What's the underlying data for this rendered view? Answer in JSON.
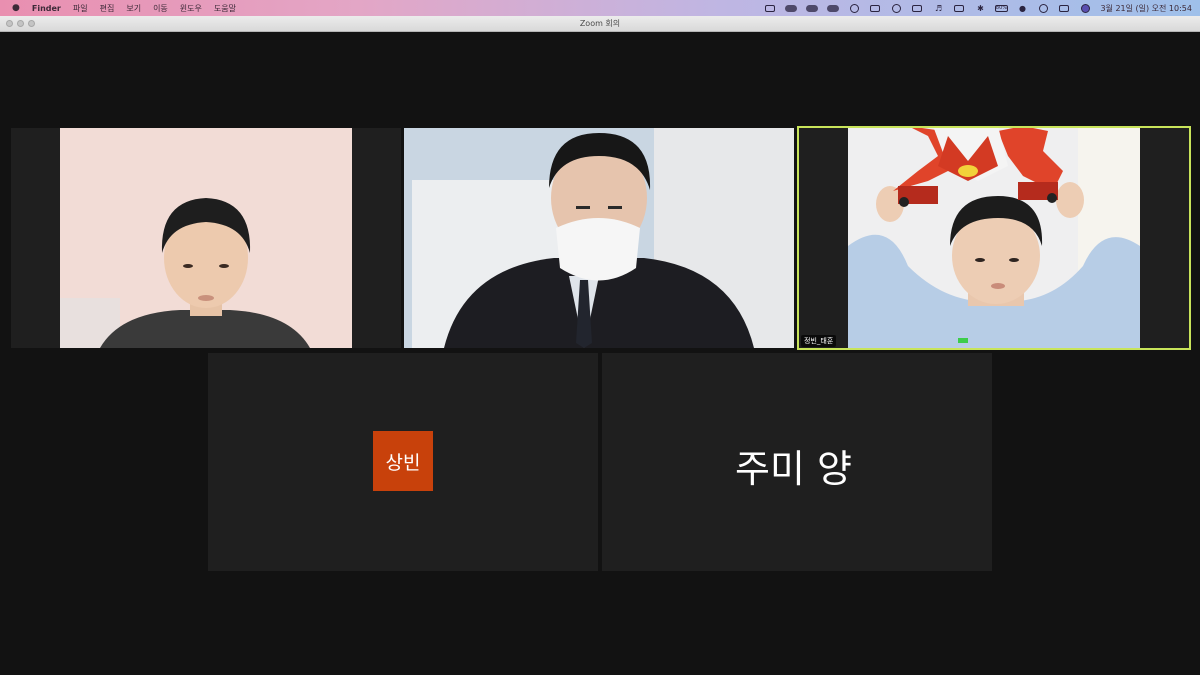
{
  "menubar": {
    "apple_icon": "apple-icon",
    "app_name": "Finder",
    "menus": [
      "파일",
      "편집",
      "보기",
      "이동",
      "윈도우",
      "도움말"
    ],
    "battery": "80%",
    "datetime": "3월 21일 (일) 오전 10:54"
  },
  "window": {
    "title": "Zoom 회의"
  },
  "participants": [
    {
      "id": "p1",
      "has_video": true
    },
    {
      "id": "p2",
      "has_video": true
    },
    {
      "id": "p3",
      "name": "정빈_태훈",
      "has_video": true,
      "active_speaker": true
    },
    {
      "id": "p4",
      "name": "상빈",
      "has_video": false,
      "avatar_color": "#c8410b"
    },
    {
      "id": "p5",
      "name": "주미 양",
      "has_video": false
    }
  ],
  "colors": {
    "background": "#121212",
    "tile": "#1f1f1f",
    "active_speaker": "#c8e45a"
  }
}
